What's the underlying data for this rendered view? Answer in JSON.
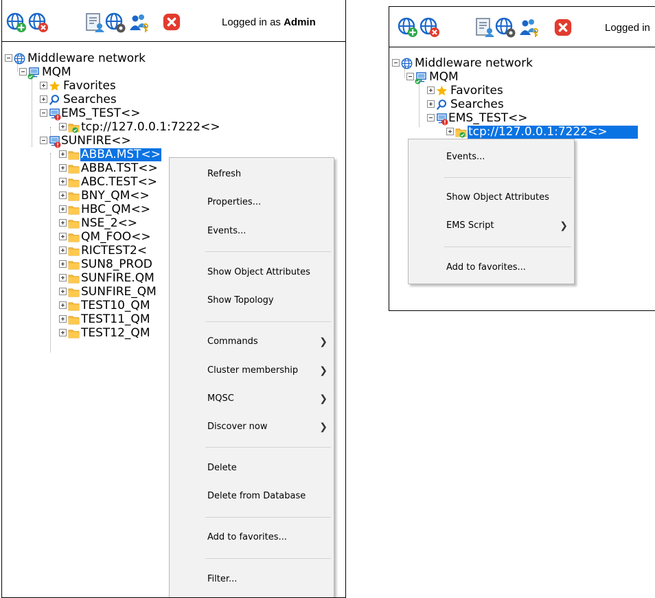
{
  "toolbar": {
    "login_prefix": "Logged in as ",
    "login_user": "Admin",
    "login_truncated": "Logged in",
    "icons": [
      "add-network-icon",
      "remove-network-icon",
      "report-icon",
      "network-settings-icon",
      "users-keys-icon",
      "close-icon"
    ]
  },
  "left_tree": {
    "root": "Middleware network",
    "mqm": "MQM",
    "favorites": "Favorites",
    "searches": "Searches",
    "ems_test": "EMS_TEST<>",
    "tcp": "tcp://127.0.0.1:7222<>",
    "sunfire": "SUNFIRE<>",
    "queue_managers": [
      "ABBA.MST<>",
      "ABBA.TST<>",
      "ABC.TEST<>",
      "BNY_QM<>",
      "HBC_QM<>",
      "NSE_2<>",
      "QM_FOO<>",
      "RICTEST2<",
      "SUN8_PROD",
      "SUNFIRE.QM",
      "SUNFIRE_QM",
      "TEST10_QM",
      "TEST11_QM",
      "TEST12_QM"
    ]
  },
  "left_menu": {
    "refresh": "Refresh",
    "properties": "Properties...",
    "events": "Events...",
    "show_object_attributes": "Show Object Attributes",
    "show_topology": "Show Topology",
    "commands": "Commands",
    "cluster_membership": "Cluster membership",
    "mqsc": "MQSC",
    "discover_now": "Discover now",
    "delete": "Delete",
    "delete_from_database": "Delete from Database",
    "add_to_favorites": "Add to favorites...",
    "filter": "Filter..."
  },
  "right_tree": {
    "root": "Middleware network",
    "mqm": "MQM",
    "favorites": "Favorites",
    "searches": "Searches",
    "ems_test": "EMS_TEST<>",
    "tcp": "tcp://127.0.0.1:7222<>"
  },
  "right_menu": {
    "events": "Events...",
    "show_object_attributes": "Show Object Attributes",
    "ems_script": "EMS Script",
    "add_to_favorites": "Add to favorites..."
  },
  "colors": {
    "selection": "#0a73e3",
    "folder": "#f5b93a",
    "globe": "#1a66c9",
    "close": "#e23b2e",
    "green": "#2ea84a"
  }
}
